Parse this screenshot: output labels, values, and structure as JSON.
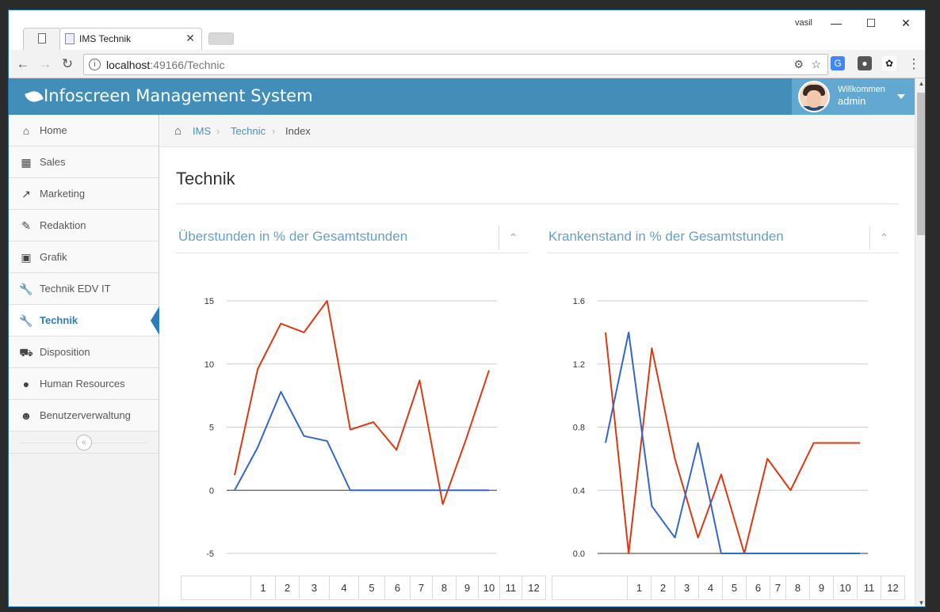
{
  "browser": {
    "tab_title": "IMS Technik",
    "tab_close": "✕",
    "window_user": "vasil",
    "url_host": "localhost",
    "url_path": ":49166/Technic"
  },
  "header": {
    "brand": "Infoscreen Management System",
    "welcome": "Willkommen",
    "username": "admin"
  },
  "sidebar": {
    "items": [
      {
        "label": "Home",
        "icon": "home-icon"
      },
      {
        "label": "Sales",
        "icon": "cart-icon"
      },
      {
        "label": "Marketing",
        "icon": "chart-line-icon"
      },
      {
        "label": "Redaktion",
        "icon": "pencil-icon"
      },
      {
        "label": "Grafik",
        "icon": "picture-icon"
      },
      {
        "label": "Technik EDV IT",
        "icon": "wrench-icon"
      },
      {
        "label": "Technik",
        "icon": "wrench-icon"
      },
      {
        "label": "Disposition",
        "icon": "truck-icon"
      },
      {
        "label": "Human Resources",
        "icon": "user-icon"
      },
      {
        "label": "Benutzerverwaltung",
        "icon": "users-icon"
      }
    ],
    "active": "Technik"
  },
  "breadcrumbs": {
    "items": [
      "IMS",
      "Technic"
    ],
    "current": "Index"
  },
  "page": {
    "title": "Technik"
  },
  "widgets": {
    "left_title": "Überstunden in % der Gesamtstunden",
    "right_title": "Krankenstand in % der Gesamtstunden"
  },
  "colors": {
    "header": "#438eb9",
    "series_red": "#dc3912",
    "series_blue": "#3366cc"
  },
  "chart_data": [
    {
      "type": "line",
      "title": "Überstunden in % der Gesamtstunden",
      "x": [
        1,
        2,
        3,
        4,
        5,
        6,
        7,
        8,
        9,
        10,
        11,
        12
      ],
      "ylim": [
        -5,
        15
      ],
      "yticks": [
        15,
        10,
        5,
        0,
        -5
      ],
      "grid": true,
      "series": [
        {
          "color": "#dc3912",
          "values": [
            1.2,
            9.6,
            13.2,
            12.5,
            15.0,
            4.8,
            5.4,
            3.2,
            8.7,
            -1.1,
            4.0,
            9.5
          ]
        },
        {
          "color": "#3366cc",
          "values": [
            0.0,
            3.4,
            7.8,
            4.3,
            3.9,
            0.0,
            0.0,
            0.0,
            0.0,
            0.0,
            0.0,
            0.0
          ]
        }
      ]
    },
    {
      "type": "line",
      "title": "Krankenstand in % der Gesamtstunden",
      "x": [
        1,
        2,
        3,
        4,
        5,
        6,
        7,
        8,
        9,
        10,
        11,
        12
      ],
      "ylim": [
        0.0,
        1.6
      ],
      "yticks": [
        "1.6",
        "1.2",
        "0.8",
        "0.4",
        "0.0"
      ],
      "grid": true,
      "series": [
        {
          "color": "#dc3912",
          "values": [
            1.4,
            0.0,
            1.3,
            0.6,
            0.1,
            0.5,
            0.0,
            0.6,
            0.4,
            0.7,
            0.7,
            0.7
          ]
        },
        {
          "color": "#3366cc",
          "values": [
            0.7,
            1.4,
            0.3,
            0.1,
            0.7,
            0.0,
            0.0,
            0.0,
            0.0,
            0.0,
            0.0,
            0.0
          ]
        }
      ]
    }
  ],
  "tables": {
    "headers": [
      "1",
      "2",
      "3",
      "4",
      "5",
      "6",
      "7",
      "8",
      "9",
      "10",
      "11",
      "12"
    ]
  }
}
